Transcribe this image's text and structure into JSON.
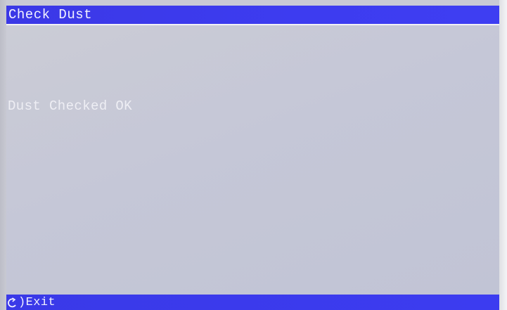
{
  "window": {
    "title": "Check Dust"
  },
  "main": {
    "message": "Dust Checked OK"
  },
  "footer": {
    "exit_icon": "return-arrow-icon",
    "exit_label": ")Exit"
  },
  "colors": {
    "bar_blue": "#3c3cf0",
    "screen_gray": "#c5c7d7",
    "text_light": "#eeeef4"
  }
}
